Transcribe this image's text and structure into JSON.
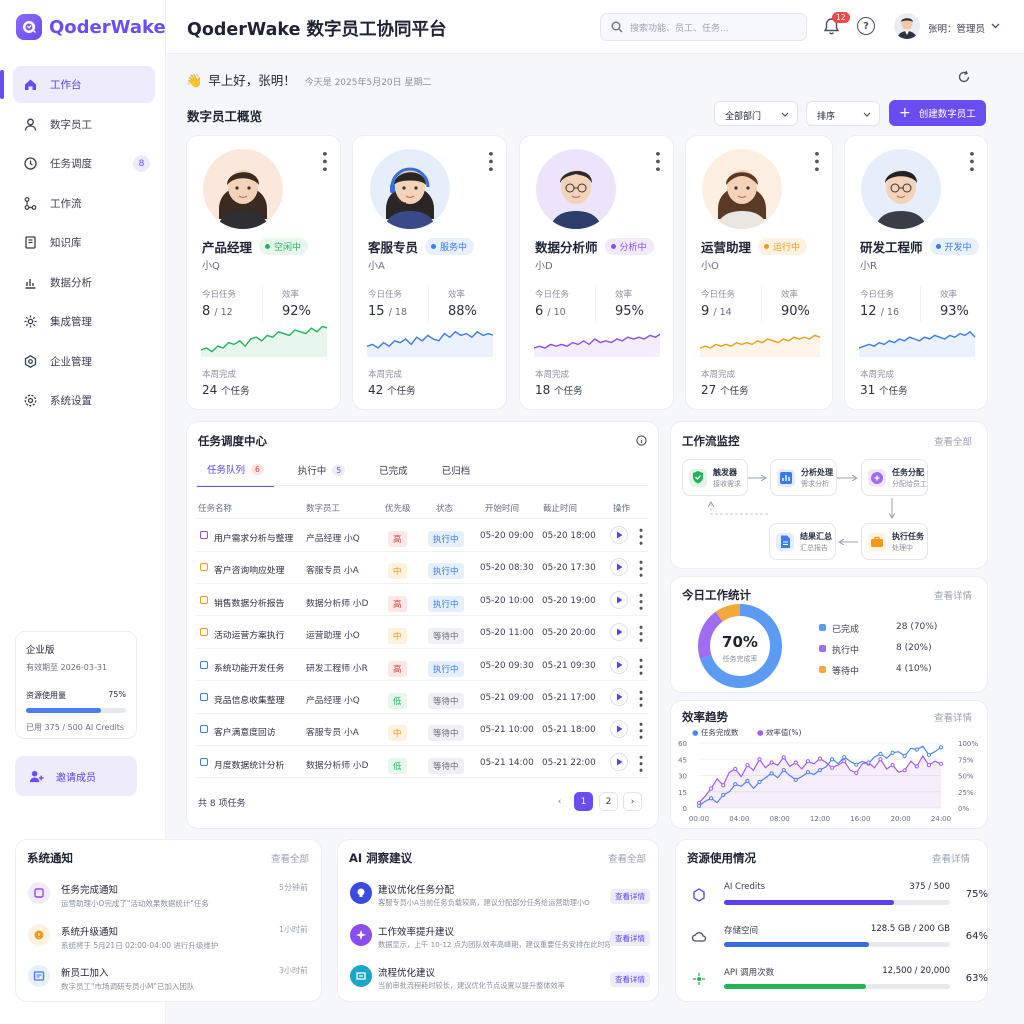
{
  "app": {
    "name": "QoderWake",
    "title": "QoderWake 数字员工协同平台"
  },
  "header": {
    "search_placeholder": "搜索功能、员工、任务...",
    "notification_count": "12",
    "help": "?",
    "user_name": "张明：管理员"
  },
  "sidebar": {
    "items": [
      {
        "label": "工作台",
        "icon": "home-icon",
        "active": true
      },
      {
        "label": "数字员工",
        "icon": "user-icon"
      },
      {
        "label": "任务调度",
        "icon": "clock-icon",
        "badge": "8"
      },
      {
        "label": "工作流",
        "icon": "workflow-icon"
      },
      {
        "label": "知识库",
        "icon": "book-icon"
      },
      {
        "label": "数据分析",
        "icon": "bar-chart-icon"
      },
      {
        "label": "集成管理",
        "icon": "gear-icon"
      },
      {
        "label": "企业管理",
        "icon": "building-icon"
      },
      {
        "label": "系统设置",
        "icon": "settings-icon"
      }
    ],
    "plan": {
      "name": "企业版",
      "expiry": "有效期至 2026-03-31",
      "usage_label": "资源使用量",
      "usage_pct": "75%",
      "usage_value": 75,
      "credits": "已用 375 / 500 AI Credits"
    },
    "invite_label": "邀请成员"
  },
  "greeting": {
    "emoji": "👋",
    "text": "早上好，张明！",
    "date": "今天是 2025年5月20日 星期二"
  },
  "overview": {
    "title": "数字员工概览",
    "filter_dept": "全部部门",
    "filter_sort": "排序",
    "create_label": "创建数字员工",
    "agents": [
      {
        "role": "产品经理",
        "nick": "小Q",
        "status": "空闲中",
        "color": "#22b45a",
        "bg": "#e8f7ee",
        "tasks": "8",
        "tasks_total": "/ 12",
        "eff": "92%",
        "week": "24",
        "week_unit": "个任务",
        "spark": [
          12,
          13,
          11,
          14,
          13,
          16,
          15,
          17,
          14,
          18,
          19,
          17,
          20,
          19,
          22,
          21,
          20,
          23,
          22,
          21,
          24,
          22,
          25,
          24
        ]
      },
      {
        "role": "客服专员",
        "nick": "小A",
        "status": "服务中",
        "color": "#3a7bf0",
        "bg": "#e8f0fd",
        "tasks": "15",
        "tasks_total": "/ 18",
        "eff": "88%",
        "week": "42",
        "week_unit": "个任务",
        "spark": [
          14,
          15,
          13,
          16,
          14,
          17,
          16,
          18,
          15,
          19,
          17,
          20,
          18,
          17,
          21,
          19,
          22,
          20,
          21,
          19,
          22,
          20,
          21,
          20
        ]
      },
      {
        "role": "数据分析师",
        "nick": "小D",
        "status": "分析中",
        "color": "#8b4ef0",
        "bg": "#f1eafd",
        "tasks": "6",
        "tasks_total": "/ 10",
        "eff": "95%",
        "week": "18",
        "week_unit": "个任务",
        "spark": [
          13,
          14,
          13,
          15,
          14,
          15,
          14,
          16,
          15,
          17,
          15,
          18,
          16,
          17,
          16,
          18,
          17,
          19,
          18,
          19,
          18,
          20,
          19,
          21
        ]
      },
      {
        "role": "运营助理",
        "nick": "小O",
        "status": "运行中",
        "color": "#f29a1a",
        "bg": "#fdf1e2",
        "tasks": "9",
        "tasks_total": "/ 14",
        "eff": "90%",
        "week": "27",
        "week_unit": "个任务",
        "spark": [
          13,
          14,
          13,
          15,
          14,
          15,
          14,
          16,
          15,
          16,
          15,
          17,
          16,
          18,
          17,
          16,
          18,
          17,
          19,
          18,
          19,
          18,
          20,
          19
        ]
      },
      {
        "role": "研发工程师",
        "nick": "小R",
        "status": "开发中",
        "color": "#3a7bf0",
        "bg": "#e8f0fd",
        "tasks": "12",
        "tasks_total": "/ 16",
        "eff": "93%",
        "week": "31",
        "week_unit": "个任务",
        "spark": [
          13,
          14,
          15,
          14,
          16,
          15,
          17,
          16,
          18,
          17,
          19,
          18,
          17,
          19,
          18,
          20,
          19,
          18,
          20,
          19,
          21,
          20,
          22,
          19
        ]
      }
    ],
    "labels": {
      "today_tasks": "今日任务",
      "efficiency": "效率",
      "week_done": "本周完成"
    }
  },
  "tasks": {
    "title": "任务调度中心",
    "tabs": [
      {
        "label": "任务队列",
        "badge": "6"
      },
      {
        "label": "执行中",
        "badge": "5"
      },
      {
        "label": "已完成"
      },
      {
        "label": "已归档"
      }
    ],
    "columns": [
      "任务名称",
      "数字员工",
      "优先级",
      "状态",
      "开始时间",
      "截止时间",
      "操作"
    ],
    "rows": [
      {
        "name": "用户需求分析与整理",
        "agent": "产品经理 小Q",
        "priority": "高",
        "status": "执行中",
        "start": "05-20 09:00",
        "end": "05-20 18:00",
        "c": "#8b4ef0"
      },
      {
        "name": "客户咨询响应处理",
        "agent": "客服专员 小A",
        "priority": "中",
        "status": "执行中",
        "start": "05-20 08:30",
        "end": "05-20 17:30",
        "c": "#f29a1a"
      },
      {
        "name": "销售数据分析报告",
        "agent": "数据分析师 小D",
        "priority": "高",
        "status": "执行中",
        "start": "05-20 10:00",
        "end": "05-20 19:00",
        "c": "#f29a1a"
      },
      {
        "name": "活动运营方案执行",
        "agent": "运营助理 小O",
        "priority": "中",
        "status": "等待中",
        "start": "05-20 11:00",
        "end": "05-20 20:00",
        "c": "#f29a1a"
      },
      {
        "name": "系统功能开发任务",
        "agent": "研发工程师 小R",
        "priority": "高",
        "status": "执行中",
        "start": "05-20 09:30",
        "end": "05-21 09:30",
        "c": "#3a7bf0"
      },
      {
        "name": "竞品信息收集整理",
        "agent": "产品经理 小Q",
        "priority": "低",
        "status": "等待中",
        "start": "05-21 09:00",
        "end": "05-21 17:00",
        "c": "#3a7bf0"
      },
      {
        "name": "客户满意度回访",
        "agent": "客服专员 小A",
        "priority": "中",
        "status": "等待中",
        "start": "05-21 10:00",
        "end": "05-21 18:00",
        "c": "#3a7bf0"
      },
      {
        "name": "月度数据统计分析",
        "agent": "数据分析师 小D",
        "priority": "低",
        "status": "等待中",
        "start": "05-21 14:00",
        "end": "05-21 22:00",
        "c": "#3a7bf0"
      }
    ],
    "total": "共 8 项任务",
    "pages": [
      "1",
      "2"
    ]
  },
  "workflow": {
    "title": "工作流监控",
    "view_all": "查看全部",
    "nodes": [
      {
        "title": "触发器",
        "sub": "接收需求",
        "icon": "shield-icon",
        "color": "#22b45a"
      },
      {
        "title": "分析处理",
        "sub": "需求分析",
        "icon": "chart-icon",
        "color": "#3a7bf0"
      },
      {
        "title": "任务分配",
        "sub": "分配给员工",
        "icon": "brain-icon",
        "color": "#8b4ef0"
      },
      {
        "title": "执行任务",
        "sub": "处理中",
        "icon": "briefcase-icon",
        "color": "#f29a1a"
      },
      {
        "title": "结果汇总",
        "sub": "汇总报告",
        "icon": "doc-icon",
        "color": "#3a7bf0"
      }
    ]
  },
  "stats": {
    "title": "今日工作统计",
    "view": "查看详情",
    "center_value": "70%",
    "center_label": "任务完成率",
    "legend": [
      {
        "label": "已完成",
        "value": "28 (70%)",
        "color": "#5b9bf3"
      },
      {
        "label": "执行中",
        "value": "8 (20%)",
        "color": "#a06cf2"
      },
      {
        "label": "等待中",
        "value": "4 (10%)",
        "color": "#f3a83a"
      }
    ]
  },
  "trend": {
    "title": "效率趋势",
    "view": "查看详情",
    "series_labels": [
      "任务完成数",
      "效率值(%)"
    ]
  },
  "chart_data": {
    "type": "line",
    "x_ticks": [
      "00:00",
      "04:00",
      "08:00",
      "12:00",
      "16:00",
      "20:00",
      "24:00"
    ],
    "y_left_ticks": [
      "0",
      "15",
      "30",
      "45",
      "60"
    ],
    "y_right_ticks": [
      "0%",
      "25%",
      "50%",
      "75%",
      "100%"
    ],
    "ylim_left": [
      0,
      60
    ],
    "ylim_right": [
      0,
      100
    ],
    "series": [
      {
        "name": "任务完成数",
        "color": "#4a86f0",
        "values": [
          2,
          6,
          9,
          5,
          12,
          15,
          22,
          20,
          25,
          18,
          24,
          28,
          32,
          28,
          35,
          30,
          26,
          29,
          33,
          31,
          35,
          38,
          45,
          41,
          47,
          43,
          40,
          43,
          41,
          47,
          50,
          46,
          51,
          52,
          48,
          55,
          54,
          57,
          49,
          52,
          56
        ]
      },
      {
        "name": "效率值(%)",
        "color": "#a45cf0",
        "values": [
          8,
          18,
          30,
          45,
          35,
          55,
          60,
          48,
          66,
          58,
          75,
          62,
          70,
          66,
          78,
          64,
          70,
          60,
          72,
          68,
          76,
          70,
          62,
          66,
          72,
          58,
          54,
          68,
          70,
          62,
          75,
          60,
          66,
          55,
          58,
          72,
          64,
          80,
          66,
          72,
          68
        ]
      }
    ]
  },
  "notices": {
    "title": "系统通知",
    "view_all": "查看全部",
    "items": [
      {
        "title": "任务完成通知",
        "desc": "运营助理小O完成了\"活动效果数据统计\"任务",
        "time": "5分钟前",
        "icon": "task-icon",
        "color": "#8b4ef0",
        "bg": "#f1eafd"
      },
      {
        "title": "系统升级通知",
        "desc": "系统将于 5月21日 02:00-04:00 进行升级维护",
        "time": "1小时前",
        "icon": "info-icon",
        "color": "#f29a1a",
        "bg": "#fdf1e2"
      },
      {
        "title": "新员工加入",
        "desc": "数字员工\"市场调研专员小M\"已加入团队",
        "time": "3小时前",
        "icon": "id-card-icon",
        "color": "#3a7bf0",
        "bg": "#e8f0fd"
      }
    ]
  },
  "insights": {
    "title": "AI 洞察建议",
    "view_all": "查看全部",
    "items": [
      {
        "title": "建议优化任务分配",
        "desc": "客服专员小A当前任务负载较高，建议分配部分任务给运营助理小O",
        "btn": "查看详情",
        "icon": "bulb-icon",
        "color": "#3a4be0"
      },
      {
        "title": "工作效率提升建议",
        "desc": "数据显示，上午 10-12 点为团队效率高峰期，建议重要任务安排在此时段",
        "btn": "查看详情",
        "icon": "sparkle-icon",
        "color": "#8b4ef0"
      },
      {
        "title": "流程优化建议",
        "desc": "当前审批流程耗时较长，建议优化节点设置以提升整体效率",
        "btn": "查看详情",
        "icon": "flow-icon",
        "color": "#19a7c4"
      }
    ]
  },
  "resources": {
    "title": "资源使用情况",
    "view": "查看详情",
    "items": [
      {
        "name": "AI Credits",
        "amount": "375 / 500",
        "pct": "75%",
        "value": 75,
        "icon": "credits-icon",
        "color": "#5b3ff0"
      },
      {
        "name": "存储空间",
        "amount": "128.5 GB / 200 GB",
        "pct": "64%",
        "value": 64,
        "icon": "cloud-icon",
        "color": "#3a6ae0"
      },
      {
        "name": "API 调用次数",
        "amount": "12,500 / 20,000",
        "pct": "63%",
        "value": 63,
        "icon": "api-icon",
        "color": "#22b45a"
      }
    ]
  }
}
